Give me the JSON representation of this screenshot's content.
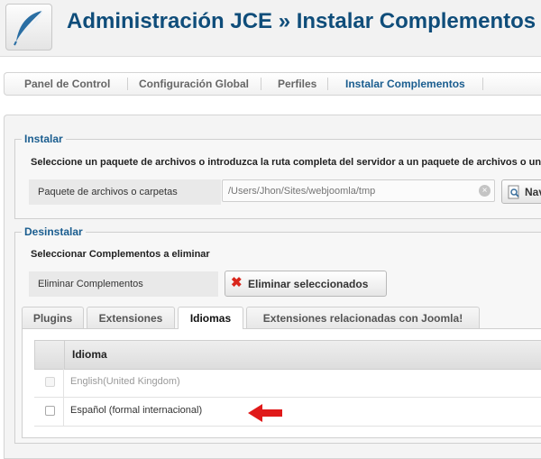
{
  "header": {
    "title": "Administración JCE » Instalar Complementos",
    "logo_icon": "feather-logo-icon"
  },
  "nav": {
    "items": [
      {
        "label": "Panel de Control",
        "active": false
      },
      {
        "label": "Configuración Global",
        "active": false
      },
      {
        "label": "Perfiles",
        "active": false
      },
      {
        "label": "Instalar Complementos",
        "active": true
      }
    ]
  },
  "install": {
    "legend": "Instalar",
    "description": "Seleccione un paquete de archivos o introduzca la ruta completa del servidor a un paquete de archivos o un",
    "package_label": "Paquete de archivos o carpetas",
    "path_placeholder": "/Users/Jhon/Sites/webjoomla/tmp",
    "browse_label": "Nav"
  },
  "uninstall": {
    "legend": "Desinstalar",
    "description": "Seleccionar Complementos a eliminar",
    "remove_label": "Eliminar Complementos",
    "remove_button": "Eliminar seleccionados",
    "tabs": [
      {
        "label": "Plugins",
        "active": false
      },
      {
        "label": "Extensiones",
        "active": false
      },
      {
        "label": "Idiomas",
        "active": true
      },
      {
        "label": "Extensiones relacionadas con Joomla!",
        "active": false
      }
    ],
    "table": {
      "column": "Idioma",
      "rows": [
        {
          "name": "English(United Kingdom)",
          "disabled": true
        },
        {
          "name": "Español (formal internacional)",
          "disabled": false
        }
      ]
    }
  },
  "colors": {
    "title": "#0f4d7a",
    "accent": "#1a5d8f",
    "arrow": "#e01a1a",
    "delete_icon": "#d9261c"
  }
}
